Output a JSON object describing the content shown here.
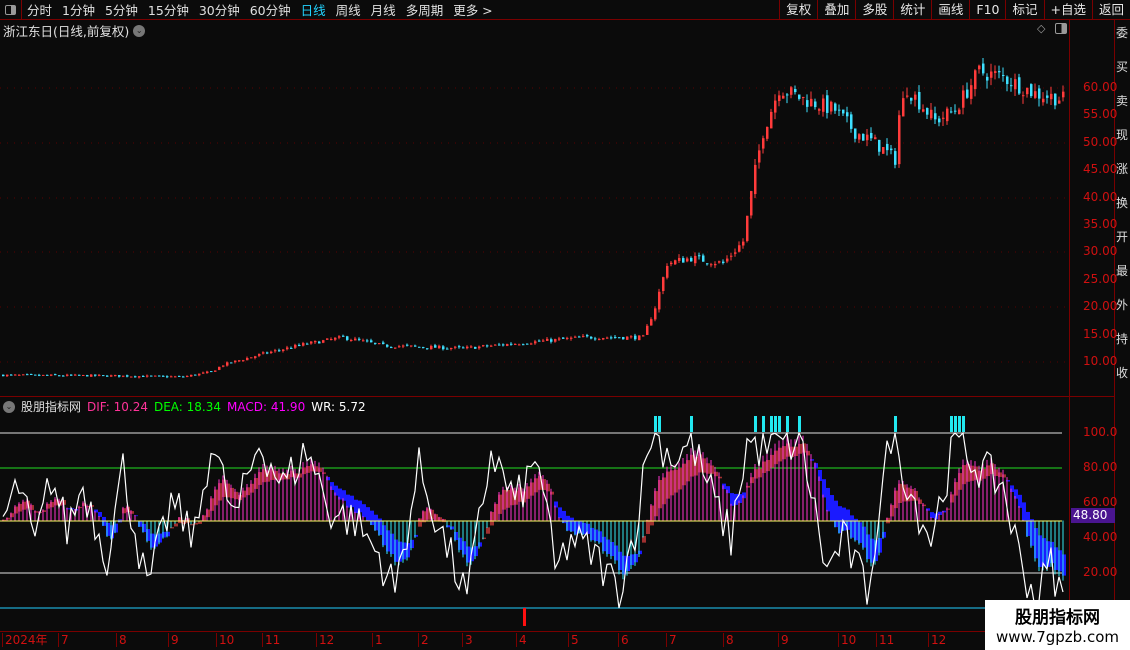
{
  "toolbar": {
    "periods": [
      "分时",
      "1分钟",
      "5分钟",
      "15分钟",
      "30分钟",
      "60分钟",
      "日线",
      "周线",
      "月线",
      "多周期",
      "更多 >"
    ],
    "active": "日线",
    "buttons": [
      "复权",
      "叠加",
      "多股",
      "统计",
      "画线",
      "F10",
      "标记",
      "+自选",
      "返回"
    ]
  },
  "main_title": "浙江东日(日线,前复权)",
  "price_axis": [
    "60.00",
    "55.00",
    "50.00",
    "45.00",
    "40.00",
    "35.00",
    "30.00",
    "25.00",
    "20.00",
    "15.00",
    "10.00"
  ],
  "indicator": {
    "name": "股朋指标网",
    "dif_label": "DIF: 10.24",
    "dea_label": "DEA: 18.34",
    "macd_label": "MACD: 41.90",
    "wr_label": "WR: 5.72",
    "axis": [
      "100.0",
      "80.00",
      "60.00",
      "40.00",
      "20.00"
    ],
    "current_value": "48.80"
  },
  "time_axis": [
    "2024年",
    "7",
    "8",
    "9",
    "10",
    "11",
    "12",
    "1",
    "2",
    "3",
    "4",
    "5",
    "6",
    "7",
    "8",
    "9",
    "10",
    "11",
    "12"
  ],
  "right_panel_chars": [
    "委",
    "买",
    "卖",
    "现",
    "涨",
    "换",
    "开",
    "最",
    "外",
    "持",
    "收"
  ],
  "watermark": {
    "title": "股朋指标网",
    "url": "www.7gpzb.com"
  },
  "colors": {
    "up": "#ff3b3b",
    "down": "#3ee0ff",
    "axis": "#d01010",
    "dif": "#ff3399",
    "dea": "#00ff00",
    "macd": "#ff00ff"
  },
  "chart_data": {
    "type": "candlestick",
    "price_range": [
      6,
      68
    ],
    "close_keypoints": [
      [
        0,
        7.6
      ],
      [
        25,
        7.5
      ],
      [
        45,
        7.3
      ],
      [
        52,
        8.2
      ],
      [
        55,
        9.5
      ],
      [
        65,
        11.5
      ],
      [
        75,
        13.2
      ],
      [
        85,
        14.5
      ],
      [
        95,
        13
      ],
      [
        115,
        12.5
      ],
      [
        130,
        13.5
      ],
      [
        145,
        14.5
      ],
      [
        160,
        14.5
      ],
      [
        163,
        20
      ],
      [
        166,
        28
      ],
      [
        172,
        29
      ],
      [
        180,
        28
      ],
      [
        185,
        32
      ],
      [
        188,
        45
      ],
      [
        190,
        52
      ],
      [
        194,
        60
      ],
      [
        200,
        58
      ],
      [
        208,
        56
      ],
      [
        213,
        52
      ],
      [
        218,
        50
      ],
      [
        223,
        47
      ],
      [
        224,
        55
      ],
      [
        226,
        60
      ],
      [
        233,
        54
      ],
      [
        238,
        56
      ],
      [
        244,
        63
      ],
      [
        250,
        62
      ],
      [
        258,
        59
      ],
      [
        265,
        58
      ]
    ],
    "wr_keypoints": [
      [
        0,
        50
      ],
      [
        4,
        70
      ],
      [
        8,
        35
      ],
      [
        12,
        75
      ],
      [
        16,
        45
      ],
      [
        20,
        70
      ],
      [
        26,
        30
      ],
      [
        30,
        80
      ],
      [
        36,
        10
      ],
      [
        42,
        60
      ],
      [
        48,
        40
      ],
      [
        52,
        95
      ],
      [
        58,
        50
      ],
      [
        64,
        95
      ],
      [
        70,
        70
      ],
      [
        76,
        90
      ],
      [
        82,
        55
      ],
      [
        88,
        50
      ],
      [
        94,
        30
      ],
      [
        98,
        10
      ],
      [
        104,
        80
      ],
      [
        110,
        40
      ],
      [
        116,
        5
      ],
      [
        122,
        90
      ],
      [
        128,
        60
      ],
      [
        134,
        85
      ],
      [
        138,
        20
      ],
      [
        142,
        40
      ],
      [
        148,
        30
      ],
      [
        154,
        10
      ],
      [
        158,
        45
      ],
      [
        162,
        100
      ],
      [
        168,
        85
      ],
      [
        172,
        95
      ],
      [
        178,
        60
      ],
      [
        182,
        40
      ],
      [
        186,
        95
      ],
      [
        190,
        90
      ],
      [
        196,
        95
      ],
      [
        200,
        90
      ],
      [
        206,
        20
      ],
      [
        210,
        40
      ],
      [
        216,
        10
      ],
      [
        222,
        100
      ],
      [
        228,
        60
      ],
      [
        232,
        40
      ],
      [
        238,
        95
      ],
      [
        244,
        80
      ],
      [
        250,
        70
      ],
      [
        254,
        30
      ],
      [
        258,
        5
      ],
      [
        262,
        25
      ],
      [
        265,
        5
      ]
    ]
  }
}
